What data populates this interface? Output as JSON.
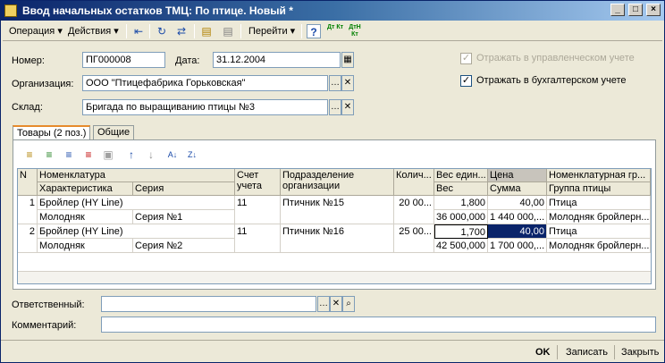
{
  "window": {
    "title": "Ввод начальных остатков ТМЦ: По птице. Новый *"
  },
  "toolbar": {
    "operation": "Операция ▾",
    "actions": "Действия ▾",
    "goto": "Перейти ▾",
    "help": "?",
    "dt_kt_1": "Дт Кт",
    "dt_kt_2": "ДтН Кт"
  },
  "form": {
    "number_label": "Номер:",
    "number_value": "ПГ000008",
    "date_label": "Дата:",
    "date_value": "31.12.2004",
    "org_label": "Организация:",
    "org_value": "ООО \"Птицефабрика Горьковская\"",
    "warehouse_label": "Склад:",
    "warehouse_value": "Бригада по выращиванию птицы №3",
    "mgmt_acc_label": "Отражать в управленческом учете",
    "book_acc_label": "Отражать в бухгалтерском учете",
    "responsible_label": "Ответственный:",
    "responsible_value": "",
    "comment_label": "Комментарий:",
    "comment_value": ""
  },
  "tabs": [
    {
      "label": "Товары (2 поз.)"
    },
    {
      "label": "Общие"
    }
  ],
  "grid": {
    "headers": {
      "n": "N",
      "nomenclature": "Номенклатура",
      "characteristic": "Характеристика",
      "series": "Серия",
      "account": "Счет учета",
      "subdivision": "Подразделение организации",
      "qty": "Колич...",
      "unit_weight": "Вес един...",
      "weight": "Вес",
      "price": "Цена",
      "sum": "Сумма",
      "nom_group": "Номенклатурная гр...",
      "bird_group": "Группа птицы"
    },
    "rows": [
      {
        "n": "1",
        "nomenclature": "Бройлер (HY Line)",
        "characteristic": "Молодняк",
        "series": "Серия №1",
        "account": "11",
        "subdivision": "Птичник №15",
        "qty": "20 00...",
        "unit_weight": "1,800",
        "weight": "36 000,000",
        "price": "40,00",
        "sum": "1 440 000,...",
        "nom_group": "Птица",
        "bird_group": "Молодняк бройлерн..."
      },
      {
        "n": "2",
        "nomenclature": "Бройлер (HY Line)",
        "characteristic": "Молодняк",
        "series": "Серия №2",
        "account": "11",
        "subdivision": "Птичник №16",
        "qty": "25 00...",
        "unit_weight": "1,700",
        "weight": "42 500,000",
        "price": "40,00",
        "sum": "1 700 000,...",
        "nom_group": "Птица",
        "bird_group": "Молодняк бройлерн..."
      }
    ]
  },
  "buttons": {
    "ok": "OK",
    "save": "Записать",
    "close": "Закрыть"
  }
}
